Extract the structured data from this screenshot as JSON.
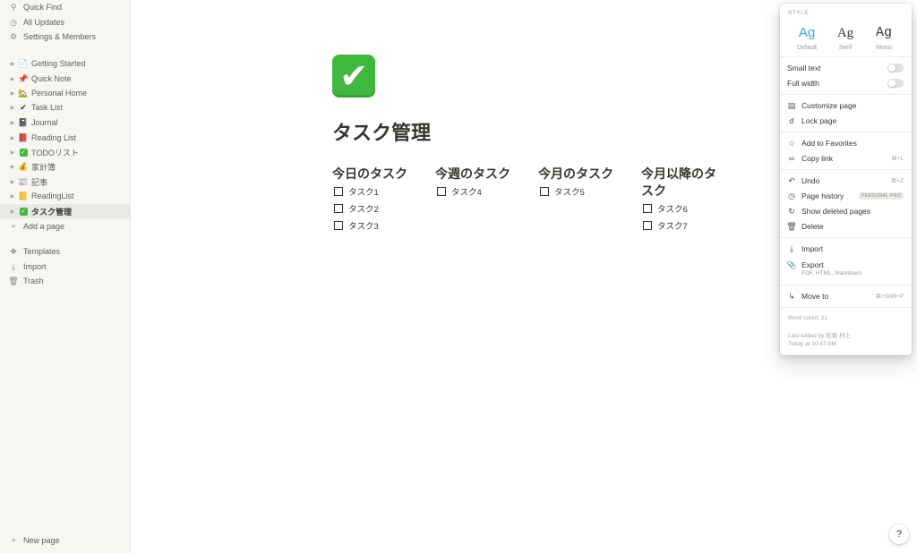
{
  "sidebar": {
    "top_items": [
      {
        "label": "Quick Find",
        "icon": "search-icon"
      },
      {
        "label": "All Updates",
        "icon": "clock-icon"
      },
      {
        "label": "Settings & Members",
        "icon": "gear-icon"
      }
    ],
    "pages": [
      {
        "label": "Getting Started",
        "icon": "page-icon"
      },
      {
        "label": "Quick Note",
        "icon": "pushpin-icon"
      },
      {
        "label": "Personal Home",
        "icon": "house-icon"
      },
      {
        "label": "Task List",
        "icon": "check-mark-icon"
      },
      {
        "label": "Journal",
        "icon": "notebook-icon"
      },
      {
        "label": "Reading List",
        "icon": "book-icon"
      },
      {
        "label": "TODOリスト",
        "icon": "check-box-icon"
      },
      {
        "label": "家計簿",
        "icon": "money-bag-icon"
      },
      {
        "label": "記事",
        "icon": "newspaper-icon"
      },
      {
        "label": "ReadingList",
        "icon": "ledger-icon"
      },
      {
        "label": "タスク管理",
        "icon": "check-box-icon"
      }
    ],
    "add_page": "Add a page",
    "bottom_items": [
      {
        "label": "Templates",
        "icon": "templates-icon"
      },
      {
        "label": "Import",
        "icon": "import-icon"
      },
      {
        "label": "Trash",
        "icon": "trash-icon"
      }
    ],
    "new_page": "New page"
  },
  "page": {
    "icon": "check-box-icon",
    "title": "タスク管理",
    "columns": [
      {
        "title": "今日のタスク",
        "tasks": [
          "タスク1",
          "タスク2",
          "タスク3"
        ]
      },
      {
        "title": "今週のタスク",
        "tasks": [
          "タスク4"
        ]
      },
      {
        "title": "今月のタスク",
        "tasks": [
          "タスク5"
        ]
      },
      {
        "title": "今月以降のタスク",
        "tasks": [
          "タスク6",
          "タスク7"
        ]
      }
    ]
  },
  "menu": {
    "style_label": "STYLE",
    "styles": [
      {
        "sample": "Ag",
        "name": "Default",
        "selected": true
      },
      {
        "sample": "Ag",
        "name": "Serif",
        "selected": false
      },
      {
        "sample": "Ag",
        "name": "Mono",
        "selected": false
      }
    ],
    "small_text": "Small text",
    "full_width": "Full width",
    "customize_page": "Customize page",
    "lock_page": "Lock page",
    "add_to_favorites": "Add to Favorites",
    "copy_link": "Copy link",
    "copy_link_shortcut": "⌘+L",
    "undo": "Undo",
    "undo_shortcut": "⌘+Z",
    "page_history": "Page history",
    "page_history_badge": "PERSONAL PRO",
    "show_deleted": "Show deleted pages",
    "delete": "Delete",
    "import": "Import",
    "export": "Export",
    "export_formats": "PDF, HTML, Markdown",
    "move_to": "Move to",
    "move_to_shortcut": "⌘+Shift+P",
    "word_count": "Word count: 21",
    "last_edited": "Last edited by 彩香 村上",
    "edited_time": "Today at 10:47 AM"
  },
  "help": "?",
  "colors": {
    "accent": "#2eaadc",
    "check_green": "#3eb93e",
    "sidebar_bg": "#f7f6f3"
  }
}
